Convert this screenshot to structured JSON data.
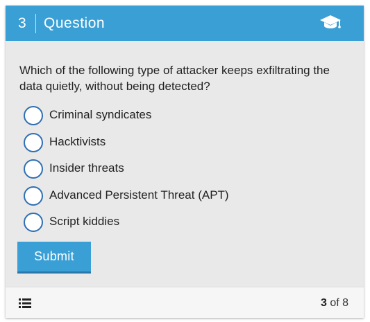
{
  "header": {
    "question_number": "3",
    "title": "Question",
    "icon": "graduation-cap-icon"
  },
  "question": {
    "text": "Which of the following type of attacker keeps exfiltrating the data quietly, without being detected?"
  },
  "options": [
    {
      "label": "Criminal syndicates",
      "selected": false
    },
    {
      "label": "Hacktivists",
      "selected": false
    },
    {
      "label": "Insider threats",
      "selected": false
    },
    {
      "label": "Advanced Persistent Threat (APT)",
      "selected": false
    },
    {
      "label": "Script kiddies",
      "selected": false
    }
  ],
  "submit_label": "Submit",
  "footer": {
    "list_icon": "list-icon",
    "current": "3",
    "of_text": "of 8"
  },
  "colors": {
    "accent": "#3a9fd5",
    "radio_border": "#2e6fb3",
    "card_background": "#e9e9e9"
  }
}
